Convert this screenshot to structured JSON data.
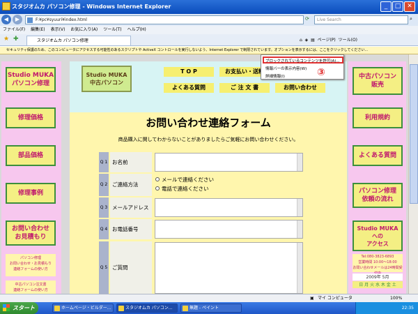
{
  "window": {
    "title": "スタジオムカ パソコン修理 - Windows Internet Explorer"
  },
  "address": {
    "url": "F:¥pc¥syuuri¥index.html",
    "search_placeholder": "Live Search"
  },
  "menu": [
    "ファイル(F)",
    "編集(E)",
    "表示(V)",
    "お気に入り(A)",
    "ツール(T)",
    "ヘルプ(H)"
  ],
  "tab": {
    "label": "スタジオムカ パソコン修理"
  },
  "toolbar": {
    "page": "ページ(P)",
    "tools": "ツール(O)"
  },
  "infobar": "セキュリティ保護のため、このコンピュータにアクセスする可能性のあるスクリプトや ActiveX コントロールを実行しないよう、Internet Explorer で制限されています。オプションを表示するには、ここをクリックしてください...",
  "context_menu": {
    "items": [
      "ブロックされているコンテンツを許可(A)...",
      "情報バーの表示内容(W)",
      "詳細情報(I)"
    ],
    "marker": "③"
  },
  "left_nav": [
    {
      "lines": [
        "Studio MUKA",
        "パソコン修理"
      ]
    },
    {
      "lines": [
        "修理価格"
      ]
    },
    {
      "lines": [
        "部品価格"
      ]
    },
    {
      "lines": [
        "修理事例"
      ]
    },
    {
      "lines": [
        "お問い合わせ",
        "お見積もり"
      ]
    }
  ],
  "left_small": [
    {
      "lines": [
        "パソコン修理",
        "お問い合わせ・お見積もり",
        "連絡フォームの使い方"
      ]
    },
    {
      "lines": [
        "中古パソコン注文書",
        "連絡フォームの使い方"
      ]
    }
  ],
  "right_nav": [
    {
      "lines": [
        "中古パソコン",
        "販売"
      ]
    },
    {
      "lines": [
        "利用規約"
      ]
    },
    {
      "lines": [
        "よくある質問"
      ]
    },
    {
      "lines": [
        "パソコン修理",
        "依頼の流れ"
      ]
    },
    {
      "lines": [
        "Studio MUKA",
        "への",
        "アクセス"
      ]
    }
  ],
  "right_info": {
    "tel": "Tel:080-3823-6893",
    "hours": "営業時間 10:00〜18:00",
    "mail": "お問い合わせメールは24時間受付中",
    "month": "2009年 5月",
    "days": "日 月 火 水 木 金 土"
  },
  "header": {
    "logo": [
      "Studio MUKA",
      "中古パソコン"
    ],
    "buttons": [
      "T O P",
      "お支払い・送料",
      "よくある質問",
      "ご 注 文 書",
      "お問い合わせ"
    ]
  },
  "form": {
    "title": "お問い合わせ連絡フォーム",
    "intro": "商品購入に関してわからないことがありましたらご気軽にお問い合わせください。",
    "rows": [
      {
        "num": "Q 1",
        "label": "お名前"
      },
      {
        "num": "Q 2",
        "label": "ご連絡方法",
        "options": [
          "メールで連絡ください",
          "電話で連絡ください"
        ]
      },
      {
        "num": "Q 3",
        "label": "メールアドレス"
      },
      {
        "num": "Q 4",
        "label": "お電話番号"
      },
      {
        "num": "Q 5",
        "label": "ご質問"
      }
    ]
  },
  "status": {
    "zone": "マイ コンピュータ",
    "zoom": "100%"
  },
  "taskbar": {
    "start": "スタート",
    "tasks": [
      "ホームページ・ビルダー...",
      "スタジオムカ パソコン...",
      "無題 - ペイント"
    ],
    "clock": "22:35"
  }
}
